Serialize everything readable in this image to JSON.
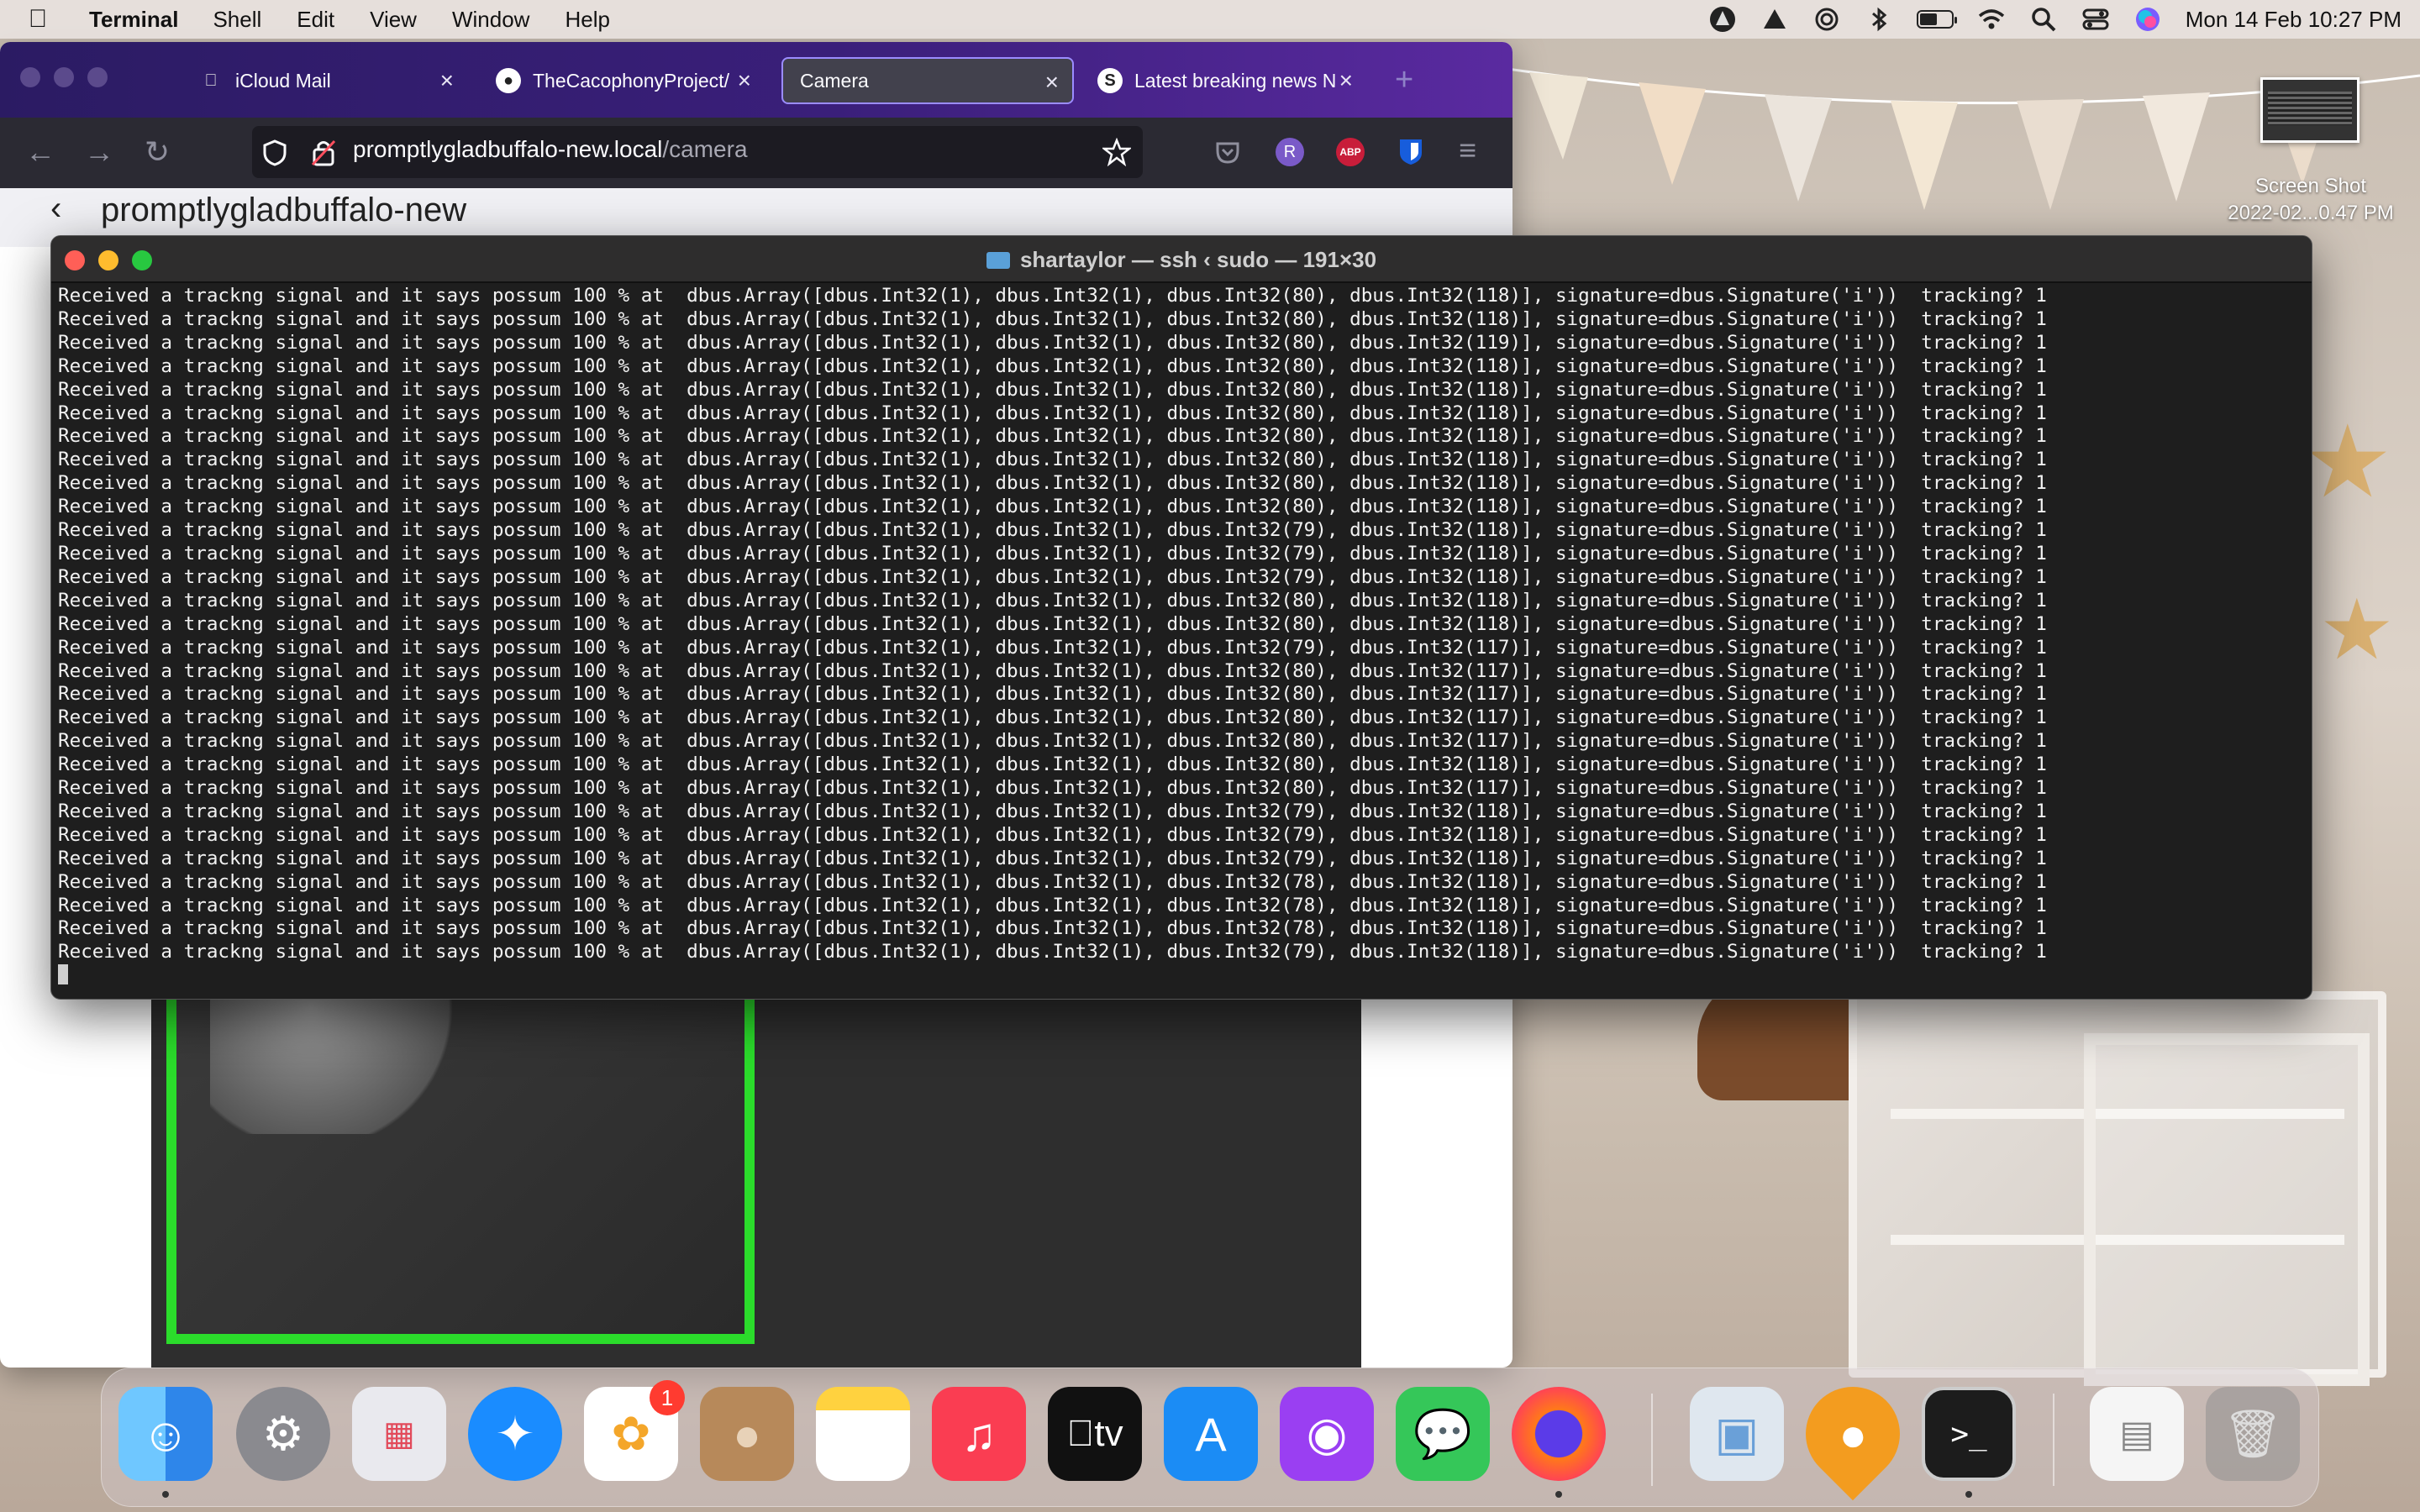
{
  "menubar": {
    "app_name": "Terminal",
    "menus": [
      "Shell",
      "Edit",
      "View",
      "Window",
      "Help"
    ],
    "datetime": "Mon 14 Feb  10:27 PM",
    "status_icons": [
      "monitor-icon",
      "drive-icon",
      "airdrop-icon",
      "bluetooth-icon",
      "battery-icon",
      "wifi-icon",
      "search-icon",
      "control-center-icon",
      "siri-icon"
    ]
  },
  "desktop": {
    "file_label_line1": "Screen Shot",
    "file_label_line2": "2022-02...0.47 PM"
  },
  "browser": {
    "tabs": [
      {
        "label": "iCloud Mail",
        "icon": "apple-icon",
        "active": false
      },
      {
        "label": "TheCacophonyProject/",
        "icon": "github-icon",
        "active": false
      },
      {
        "label": "Camera",
        "icon": "",
        "active": true
      },
      {
        "label": "Latest breaking news N",
        "icon": "stuff-icon",
        "active": false
      }
    ],
    "url_host": "promptlygladbuffalo-new.local",
    "url_path": "/camera",
    "page_title": "promptlygladbuffalo-new",
    "toolbar_icons": [
      "pocket-icon",
      "profile-r-icon",
      "adblock-icon",
      "bitwarden-icon",
      "menu-icon"
    ],
    "profile_letter": "R",
    "adblock_label": "ABP"
  },
  "terminal": {
    "title": "shartaylor — ssh ‹ sudo — 191×30",
    "lines": [
      [
        "80",
        "118"
      ],
      [
        "80",
        "118"
      ],
      [
        "80",
        "119"
      ],
      [
        "80",
        "118"
      ],
      [
        "80",
        "118"
      ],
      [
        "80",
        "118"
      ],
      [
        "80",
        "118"
      ],
      [
        "80",
        "118"
      ],
      [
        "80",
        "118"
      ],
      [
        "80",
        "118"
      ],
      [
        "79",
        "118"
      ],
      [
        "79",
        "118"
      ],
      [
        "79",
        "118"
      ],
      [
        "80",
        "118"
      ],
      [
        "80",
        "118"
      ],
      [
        "79",
        "117"
      ],
      [
        "80",
        "117"
      ],
      [
        "80",
        "117"
      ],
      [
        "80",
        "117"
      ],
      [
        "80",
        "117"
      ],
      [
        "80",
        "118"
      ],
      [
        "80",
        "117"
      ],
      [
        "79",
        "118"
      ],
      [
        "79",
        "118"
      ],
      [
        "79",
        "118"
      ],
      [
        "78",
        "118"
      ],
      [
        "78",
        "118"
      ],
      [
        "78",
        "118"
      ],
      [
        "79",
        "118"
      ]
    ],
    "line_prefix": "Received a trackng signal and it says possum 100 % at  dbus.Array([dbus.Int32(1), dbus.Int32(1), dbus.Int32(",
    "line_mid": "), dbus.Int32(",
    "line_suffix": ")], signature=dbus.Signature('i'))  tracking? 1"
  },
  "dock": {
    "apps": [
      "Finder",
      "System Preferences",
      "Launchpad",
      "Safari",
      "Photos",
      "Contacts",
      "Notes",
      "Music",
      "TV",
      "App Store",
      "Podcasts",
      "Messages",
      "Firefox",
      "Preview",
      "Maps Pin",
      "Terminal",
      "Documents",
      "Trash"
    ],
    "photos_badge": "1",
    "tv_label": "tv"
  },
  "colors": {
    "terminal_bg": "#1e1e1e",
    "terminal_fg": "#f2f2f2",
    "browser_tabbar": "#3a1f7a",
    "active_tab_border": "#9b8cff",
    "camera_box": "#2bdc2b"
  }
}
